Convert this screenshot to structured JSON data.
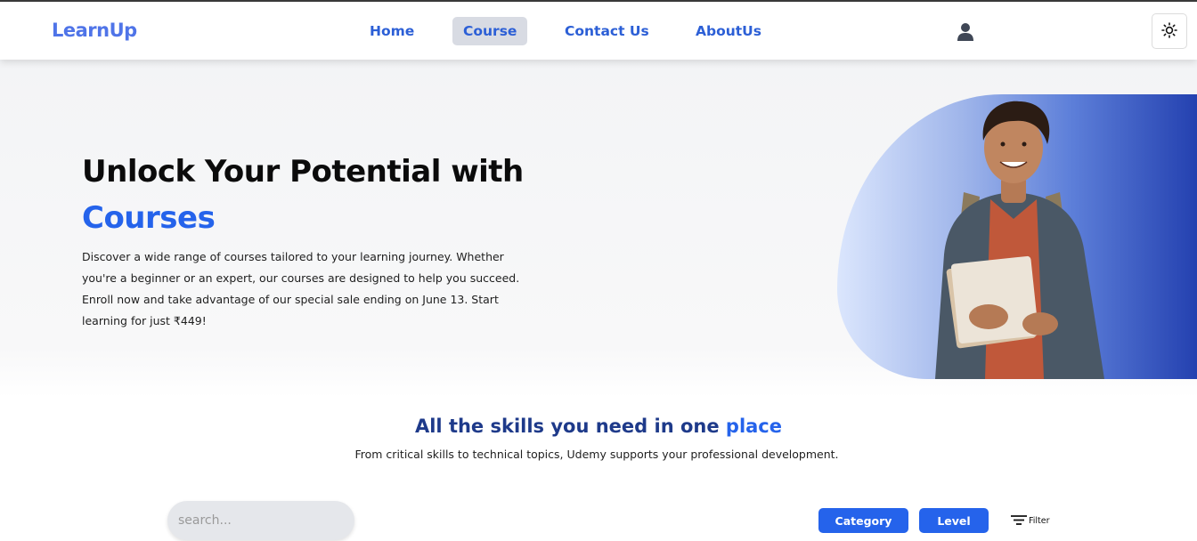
{
  "header": {
    "logo": "LearnUp",
    "nav": [
      {
        "label": "Home",
        "active": false
      },
      {
        "label": "Course",
        "active": true
      },
      {
        "label": "Contact Us",
        "active": false
      },
      {
        "label": "AboutUs",
        "active": false
      }
    ],
    "icons": {
      "user": "user-icon",
      "theme": "sun-icon"
    }
  },
  "hero": {
    "title_line1": "Unlock Your Potential with",
    "title_line2": "Courses",
    "description": "Discover a wide range of courses tailored to your learning journey. Whether you're a beginner or an expert, our courses are designed to help you succeed. Enroll now and take advantage of our special sale ending on June 13. Start learning for just ₹449!",
    "image": "student-holding-books-illustration"
  },
  "skills": {
    "title_main": "All the skills you need in one",
    "title_accent": "place",
    "subtitle": "From critical skills to technical topics, Udemy supports your professional development."
  },
  "controls": {
    "search_placeholder": "search...",
    "category_label": "Category",
    "level_label": "Level",
    "filter_label": "Filter"
  },
  "colors": {
    "accent": "#2563eb",
    "nav_text": "#2c5fd6",
    "heading_dark": "#1e3a8a",
    "logo": "#4f74e8",
    "active_nav_bg": "#d8dbe3"
  }
}
